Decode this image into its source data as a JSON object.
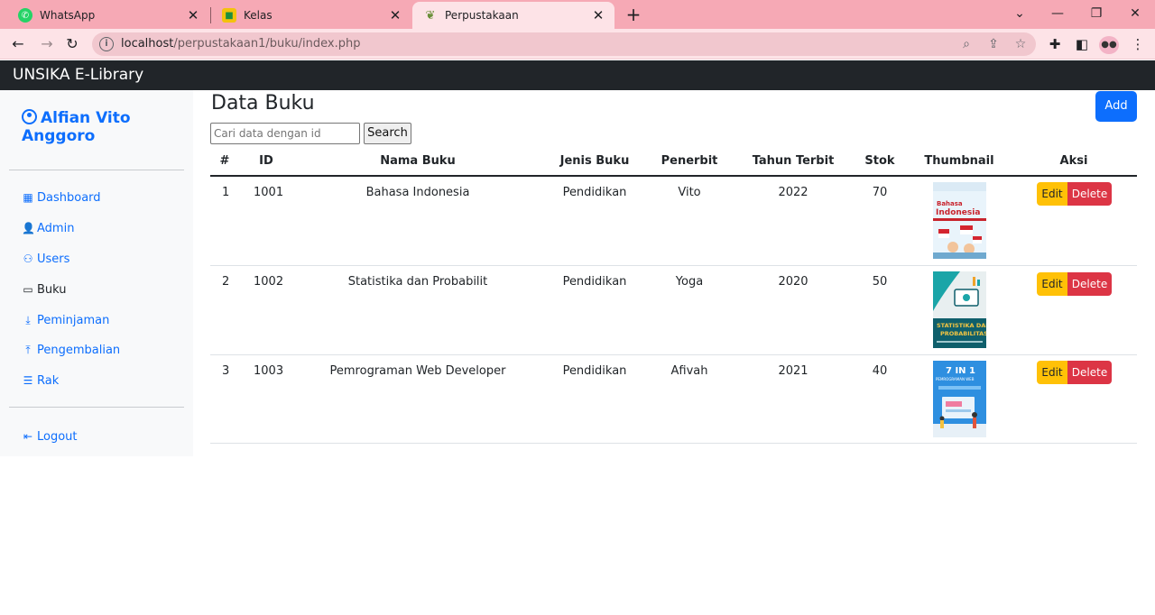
{
  "browser": {
    "tabs": [
      {
        "title": "WhatsApp",
        "icon": "whatsapp-icon"
      },
      {
        "title": "Kelas",
        "icon": "classroom-icon"
      },
      {
        "title": "Perpustakaan",
        "icon": "library-icon"
      }
    ],
    "url_host": "localhost",
    "url_path": "/perpustakaan1/buku/index.php"
  },
  "app": {
    "brand": "UNSIKA E-Library"
  },
  "sidebar": {
    "user_first": "Alfian Vito",
    "user_last": "Anggoro",
    "items": [
      {
        "label": "Dashboard",
        "icon": "dashboard-icon"
      },
      {
        "label": "Admin",
        "icon": "admin-icon"
      },
      {
        "label": "Users",
        "icon": "users-icon"
      },
      {
        "label": "Buku",
        "icon": "book-icon"
      },
      {
        "label": "Peminjaman",
        "icon": "borrow-icon"
      },
      {
        "label": "Pengembalian",
        "icon": "return-icon"
      },
      {
        "label": "Rak",
        "icon": "shelf-icon"
      }
    ],
    "logout": "Logout"
  },
  "main": {
    "title": "Data Buku",
    "add_label": "Add",
    "search_placeholder": "Cari data dengan id",
    "search_label": "Search",
    "columns": [
      "#",
      "ID",
      "Nama Buku",
      "Jenis Buku",
      "Penerbit",
      "Tahun Terbit",
      "Stok",
      "Thumbnail",
      "Aksi"
    ],
    "rows": [
      {
        "no": "1",
        "id": "1001",
        "nama": "Bahasa Indonesia",
        "jenis": "Pendidikan",
        "penerbit": "Vito",
        "tahun": "2022",
        "stok": "70",
        "edit": "Edit",
        "delete": "Delete"
      },
      {
        "no": "2",
        "id": "1002",
        "nama": "Statistika dan Probabilit",
        "jenis": "Pendidikan",
        "penerbit": "Yoga",
        "tahun": "2020",
        "stok": "50",
        "edit": "Edit",
        "delete": "Delete"
      },
      {
        "no": "3",
        "id": "1003",
        "nama": "Pemrograman Web Developer",
        "jenis": "Pendidikan",
        "penerbit": "Afivah",
        "tahun": "2021",
        "stok": "40",
        "edit": "Edit",
        "delete": "Delete"
      }
    ],
    "thumbnails": [
      {
        "line1": "Bahasa",
        "line2": "Indonesia"
      },
      {
        "line1": "STATISTIKA DAN",
        "line2": "PROBABILITAS"
      },
      {
        "line1": "7 IN 1",
        "line2": "PEMROGRAMAN WEB"
      }
    ]
  },
  "colors": {
    "tabbar": "#f6a9b5",
    "toolbar": "#fde3e7",
    "appbar": "#212529",
    "primary": "#0d6efd",
    "warning": "#ffc107",
    "danger": "#dc3545"
  }
}
